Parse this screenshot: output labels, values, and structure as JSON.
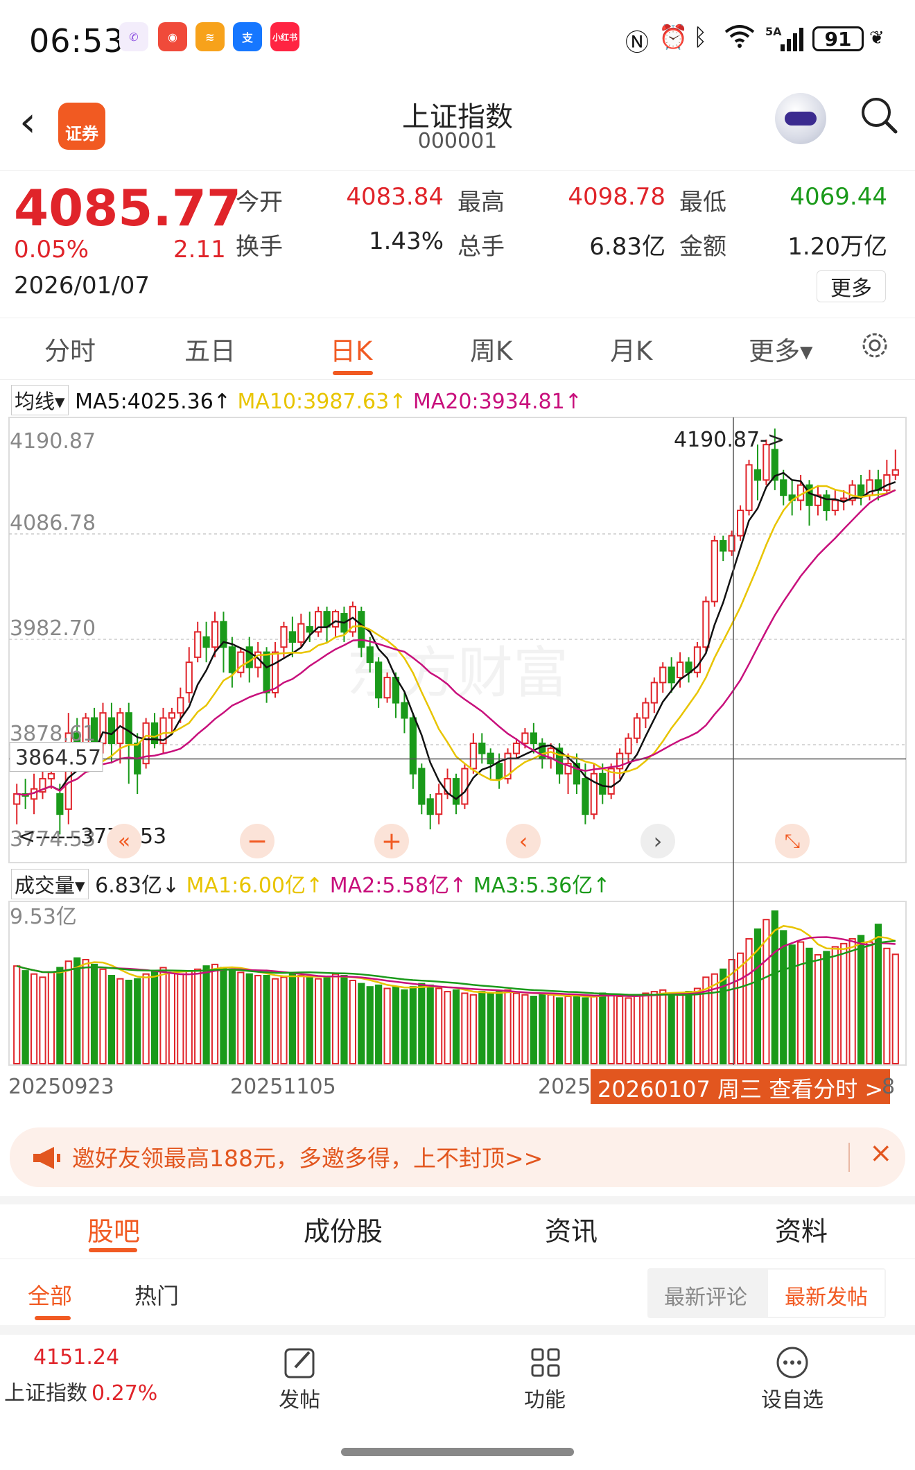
{
  "status_bar": {
    "time": "06:53",
    "network": "5A",
    "battery": "91"
  },
  "header": {
    "logo_text": "证券",
    "title": "上证指数",
    "code": "000001"
  },
  "quote": {
    "price": "4085.77",
    "change_pct": "0.05%",
    "change": "2.11",
    "date": "2026/01/07",
    "labels": {
      "open": "今开",
      "high": "最高",
      "low": "最低",
      "turnover": "换手",
      "volume": "总手",
      "amount": "金额"
    },
    "open": "4083.84",
    "high": "4098.78",
    "low": "4069.44",
    "turnover": "1.43%",
    "volume": "6.83亿",
    "amount": "1.20万亿",
    "more": "更多"
  },
  "tabs": [
    "分时",
    "五日",
    "日K",
    "周K",
    "月K",
    "更多▾"
  ],
  "active_tab": "日K",
  "ma_bar": {
    "selector": "均线",
    "ma5": "MA5:4025.36↑",
    "ma10": "MA10:3987.63↑",
    "ma20": "MA20:3934.81↑"
  },
  "chart": {
    "y_labels": [
      "4190.87",
      "4086.78",
      "3982.70",
      "3878.61",
      "3774.53"
    ],
    "max_marker": "4190.87->",
    "min_marker": "<------3774.53",
    "cursor_value": "3864.57",
    "watermark": "东方财富"
  },
  "volume": {
    "selector": "成交量",
    "value": "6.83亿↓",
    "ma1": "MA1:6.00亿↑",
    "ma2": "MA2:5.58亿↑",
    "ma3": "MA3:5.36亿↑",
    "max_label": "9.53亿"
  },
  "x_labels": [
    "20250923",
    "20251105",
    "2025"
  ],
  "x_tooltip": "20260107 周三 查看分时 >",
  "x_tail": "8",
  "colors": {
    "up": "#e0242a",
    "down": "#1a9a1a",
    "accent": "#f15a22",
    "ma5": "#111111",
    "ma10": "#e8c400",
    "ma20": "#c8107c"
  },
  "chart_data": {
    "type": "candlestick",
    "ylim": [
      3774.53,
      4190.87
    ],
    "candles": [
      [
        3820,
        3830,
        3800,
        3840
      ],
      [
        3830,
        3828,
        3815,
        3845
      ],
      [
        3825,
        3835,
        3810,
        3850
      ],
      [
        3832,
        3845,
        3825,
        3860
      ],
      [
        3845,
        3850,
        3835,
        3860
      ],
      [
        3830,
        3810,
        3790,
        3840
      ],
      [
        3815,
        3890,
        3800,
        3910
      ],
      [
        3890,
        3870,
        3860,
        3905
      ],
      [
        3870,
        3905,
        3860,
        3910
      ],
      [
        3905,
        3880,
        3870,
        3915
      ],
      [
        3880,
        3910,
        3870,
        3920
      ],
      [
        3905,
        3880,
        3860,
        3920
      ],
      [
        3880,
        3910,
        3860,
        3915
      ],
      [
        3910,
        3880,
        3840,
        3920
      ],
      [
        3880,
        3850,
        3830,
        3890
      ],
      [
        3860,
        3900,
        3855,
        3905
      ],
      [
        3900,
        3880,
        3875,
        3910
      ],
      [
        3880,
        3905,
        3870,
        3915
      ],
      [
        3905,
        3910,
        3890,
        3915
      ],
      [
        3910,
        3925,
        3900,
        3935
      ],
      [
        3930,
        3960,
        3920,
        3975
      ],
      [
        3965,
        3990,
        3960,
        4000
      ],
      [
        3985,
        3975,
        3960,
        4000
      ],
      [
        3975,
        4000,
        3965,
        4010
      ],
      [
        4000,
        3975,
        3950,
        4010
      ],
      [
        3975,
        3950,
        3935,
        3985
      ],
      [
        3950,
        3970,
        3945,
        3975
      ],
      [
        3975,
        3955,
        3940,
        3985
      ],
      [
        3955,
        3970,
        3945,
        3980
      ],
      [
        3970,
        3930,
        3920,
        3975
      ],
      [
        3930,
        3970,
        3925,
        3980
      ],
      [
        3975,
        3995,
        3965,
        4000
      ],
      [
        3990,
        3980,
        3965,
        4005
      ],
      [
        3980,
        3998,
        3975,
        4008
      ],
      [
        3995,
        3990,
        3980,
        4010
      ],
      [
        3990,
        4010,
        3985,
        4015
      ],
      [
        4010,
        3995,
        3980,
        4015
      ],
      [
        3995,
        4010,
        3985,
        4012
      ],
      [
        4008,
        3990,
        3980,
        4015
      ],
      [
        3990,
        4015,
        3985,
        4020
      ],
      [
        4010,
        3975,
        3965,
        4015
      ],
      [
        3975,
        3960,
        3950,
        3985
      ],
      [
        3960,
        3925,
        3915,
        3965
      ],
      [
        3925,
        3945,
        3920,
        3950
      ],
      [
        3945,
        3920,
        3905,
        3950
      ],
      [
        3920,
        3905,
        3890,
        3930
      ],
      [
        3905,
        3850,
        3835,
        3910
      ],
      [
        3855,
        3820,
        3810,
        3860
      ],
      [
        3825,
        3810,
        3795,
        3830
      ],
      [
        3810,
        3830,
        3800,
        3840
      ],
      [
        3830,
        3845,
        3825,
        3855
      ],
      [
        3845,
        3820,
        3810,
        3850
      ],
      [
        3820,
        3855,
        3815,
        3860
      ],
      [
        3855,
        3880,
        3850,
        3890
      ],
      [
        3880,
        3870,
        3860,
        3890
      ],
      [
        3870,
        3860,
        3845,
        3875
      ],
      [
        3860,
        3845,
        3835,
        3870
      ],
      [
        3845,
        3870,
        3840,
        3875
      ],
      [
        3870,
        3880,
        3865,
        3885
      ],
      [
        3880,
        3890,
        3875,
        3895
      ],
      [
        3890,
        3880,
        3870,
        3900
      ],
      [
        3880,
        3865,
        3855,
        3885
      ],
      [
        3865,
        3875,
        3855,
        3880
      ],
      [
        3875,
        3850,
        3840,
        3880
      ],
      [
        3850,
        3860,
        3830,
        3870
      ],
      [
        3860,
        3840,
        3830,
        3870
      ],
      [
        3845,
        3810,
        3800,
        3860
      ],
      [
        3810,
        3850,
        3805,
        3860
      ],
      [
        3850,
        3830,
        3820,
        3860
      ],
      [
        3830,
        3855,
        3825,
        3860
      ],
      [
        3855,
        3870,
        3845,
        3875
      ],
      [
        3870,
        3885,
        3860,
        3890
      ],
      [
        3885,
        3905,
        3880,
        3910
      ],
      [
        3905,
        3920,
        3895,
        3925
      ],
      [
        3920,
        3940,
        3910,
        3945
      ],
      [
        3940,
        3955,
        3930,
        3960
      ],
      [
        3955,
        3940,
        3930,
        3965
      ],
      [
        3945,
        3960,
        3935,
        3970
      ],
      [
        3960,
        3950,
        3940,
        3965
      ],
      [
        3950,
        3975,
        3945,
        3980
      ],
      [
        3975,
        4020,
        3970,
        4025
      ],
      [
        4020,
        4080,
        4015,
        4085
      ],
      [
        4080,
        4070,
        4060,
        4085
      ],
      [
        4070,
        4085,
        4065,
        4090
      ],
      [
        4085,
        4110,
        4080,
        4115
      ],
      [
        4110,
        4155,
        4105,
        4160
      ],
      [
        4150,
        4140,
        4120,
        4175
      ],
      [
        4140,
        4175,
        4135,
        4180
      ],
      [
        4170,
        4140,
        4130,
        4190.87
      ],
      [
        4140,
        4125,
        4115,
        4150
      ],
      [
        4125,
        4120,
        4105,
        4140
      ],
      [
        4120,
        4135,
        4110,
        4145
      ],
      [
        4135,
        4115,
        4095,
        4140
      ],
      [
        4115,
        4125,
        4105,
        4135
      ],
      [
        4125,
        4110,
        4100,
        4130
      ],
      [
        4110,
        4120,
        4105,
        4130
      ],
      [
        4120,
        4122,
        4110,
        4130
      ],
      [
        4120,
        4135,
        4115,
        4140
      ],
      [
        4135,
        4125,
        4115,
        4145
      ],
      [
        4125,
        4140,
        4120,
        4150
      ],
      [
        4140,
        4130,
        4120,
        4150
      ],
      [
        4130,
        4145,
        4125,
        4160
      ],
      [
        4145,
        4150,
        4140,
        4170
      ]
    ],
    "volume_max": 9.53,
    "volumes": [
      6.1,
      5.8,
      5.6,
      5.4,
      5.7,
      6.0,
      6.4,
      6.6,
      6.5,
      6.2,
      5.9,
      5.5,
      5.3,
      5.2,
      5.3,
      5.6,
      5.8,
      6.0,
      5.7,
      5.6,
      5.8,
      5.9,
      6.1,
      6.2,
      6.0,
      5.9,
      5.7,
      5.6,
      5.5,
      5.5,
      5.3,
      5.4,
      5.6,
      5.5,
      5.4,
      5.3,
      5.4,
      5.6,
      5.5,
      5.2,
      5.0,
      4.8,
      4.9,
      4.7,
      4.8,
      4.6,
      4.8,
      5.0,
      4.9,
      4.7,
      4.5,
      4.6,
      4.4,
      4.3,
      4.5,
      4.4,
      4.5,
      4.6,
      4.4,
      4.3,
      4.2,
      4.4,
      4.3,
      4.1,
      4.2,
      4.3,
      4.1,
      4.2,
      4.4,
      4.3,
      4.2,
      4.1,
      4.3,
      4.4,
      4.5,
      4.6,
      4.3,
      4.4,
      4.5,
      4.7,
      5.4,
      5.6,
      5.9,
      6.5,
      6.9,
      7.8,
      8.4,
      9.0,
      9.53,
      8.3,
      7.4,
      7.6,
      7.2,
      6.8,
      7.0,
      7.3,
      7.5,
      7.8,
      8.0,
      7.6,
      8.7,
      7.2,
      6.83
    ]
  },
  "promo": {
    "text": "邀好友领最高188元，多邀多得，上不封顶>>"
  },
  "content_tabs": [
    "股吧",
    "成份股",
    "资讯",
    "资料"
  ],
  "sub_tabs": {
    "all": "全部",
    "hot": "热门",
    "latest_comment": "最新评论",
    "latest_post": "最新发帖"
  },
  "bottom_bar": {
    "index_value": "4151.24",
    "index_name": "上证指数",
    "index_pct": "0.27%",
    "post": "发帖",
    "functions": "功能",
    "add": "设自选"
  }
}
